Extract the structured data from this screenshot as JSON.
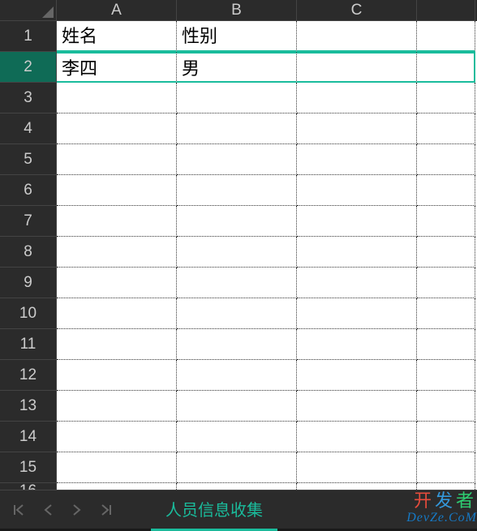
{
  "columns": [
    "A",
    "B",
    "C"
  ],
  "row_count": 16,
  "selected_row": 2,
  "cells": {
    "A1": "姓名",
    "B1": "性别",
    "A2": "李四",
    "B2": "男"
  },
  "sheet_tab": "人员信息收集",
  "watermark": {
    "line1_chars": [
      "开",
      "发",
      "者"
    ],
    "line2": "DevZe.CoM"
  },
  "nav": {
    "first": "first-sheet",
    "prev": "prev-sheet",
    "next": "next-sheet",
    "last": "last-sheet"
  }
}
